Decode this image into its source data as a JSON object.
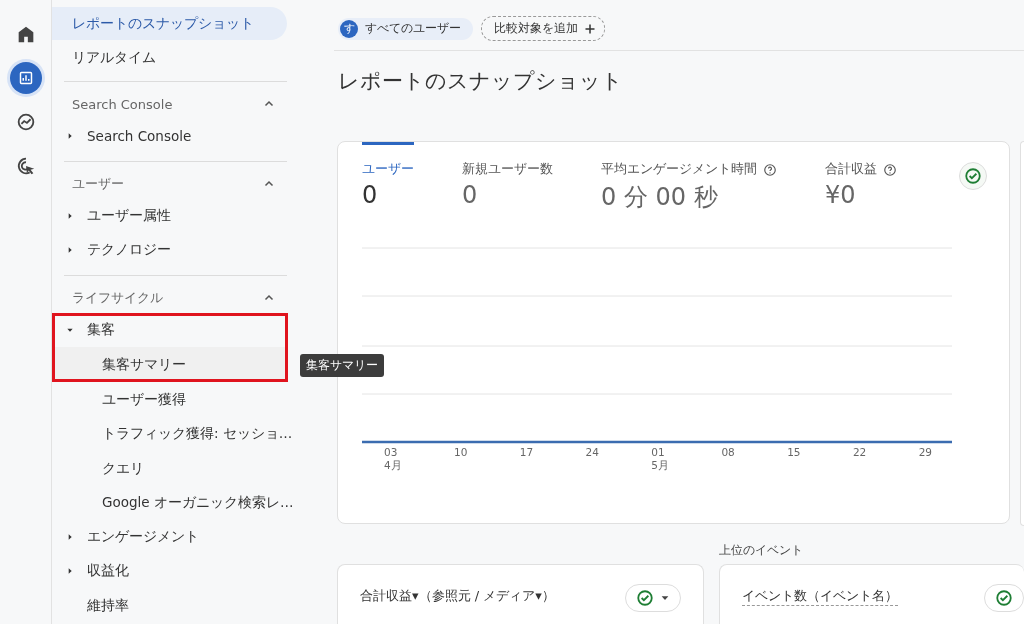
{
  "rail": {
    "items": [
      {
        "kind": "home",
        "selected": false
      },
      {
        "kind": "reports",
        "selected": true
      },
      {
        "kind": "explore",
        "selected": false
      },
      {
        "kind": "advertising",
        "selected": false
      }
    ]
  },
  "sidebar": {
    "top_items": [
      {
        "label": "レポートのスナップショット",
        "selected": true
      },
      {
        "label": "リアルタイム",
        "selected": false
      }
    ],
    "sections": [
      {
        "title": "Search Console",
        "expanded": true,
        "items": [
          {
            "kind": "group",
            "label": "Search Console",
            "expanded": false
          }
        ]
      },
      {
        "title": "ユーザー",
        "expanded": true,
        "items": [
          {
            "kind": "group",
            "label": "ユーザー属性",
            "expanded": false
          },
          {
            "kind": "group",
            "label": "テクノロジー",
            "expanded": false
          }
        ]
      },
      {
        "title": "ライフサイクル",
        "expanded": true,
        "items": [
          {
            "kind": "group",
            "label": "集客",
            "expanded": true,
            "highlighted": true,
            "children": [
              {
                "label": "集客サマリー",
                "hovered": true,
                "highlighted": true
              },
              {
                "label": "ユーザー獲得",
                "hovered": false,
                "highlighted": false
              },
              {
                "label": "トラフィック獲得: セッショ…",
                "hovered": false,
                "highlighted": false
              },
              {
                "label": "クエリ",
                "hovered": false,
                "highlighted": false
              },
              {
                "label": "Google オーガニック検索レ…",
                "hovered": false,
                "highlighted": false
              }
            ]
          },
          {
            "kind": "group",
            "label": "エンゲージメント",
            "expanded": false
          },
          {
            "kind": "group",
            "label": "収益化",
            "expanded": false
          },
          {
            "kind": "link",
            "label": "維持率"
          }
        ]
      }
    ]
  },
  "annotation": {
    "color": "#e0141e"
  },
  "tooltip": {
    "text": "集客サマリー"
  },
  "comparison": {
    "segment": {
      "badge": "す",
      "label": "すべてのユーザー"
    },
    "add_button": "比較対象を追加"
  },
  "page_title": "レポートのスナップショット",
  "metrics": [
    {
      "label": "ユーザー",
      "value": "0",
      "help": false,
      "selected": true
    },
    {
      "label": "新規ユーザー数",
      "value": "0",
      "help": false,
      "selected": false
    },
    {
      "label": "平均エンゲージメント時間",
      "value": "0 分 00 秒",
      "help": true,
      "selected": false
    },
    {
      "label": "合計収益",
      "value": "¥0",
      "help": true,
      "selected": false
    }
  ],
  "chart": {
    "x_labels": [
      {
        "day": "03",
        "month": "4月"
      },
      {
        "day": "10"
      },
      {
        "day": "17"
      },
      {
        "day": "24"
      },
      {
        "day": "01",
        "month": "5月"
      },
      {
        "day": "08"
      },
      {
        "day": "15"
      },
      {
        "day": "22"
      },
      {
        "day": "29"
      }
    ]
  },
  "bottom_cards": [
    {
      "title": "合計収益▾（参照元 / メディア▾）",
      "dotted": false,
      "menu_caret": true
    },
    {
      "heading": "上位のイベント",
      "title": "イベント数（イベント名）",
      "dotted": true,
      "menu_caret": false
    }
  ]
}
